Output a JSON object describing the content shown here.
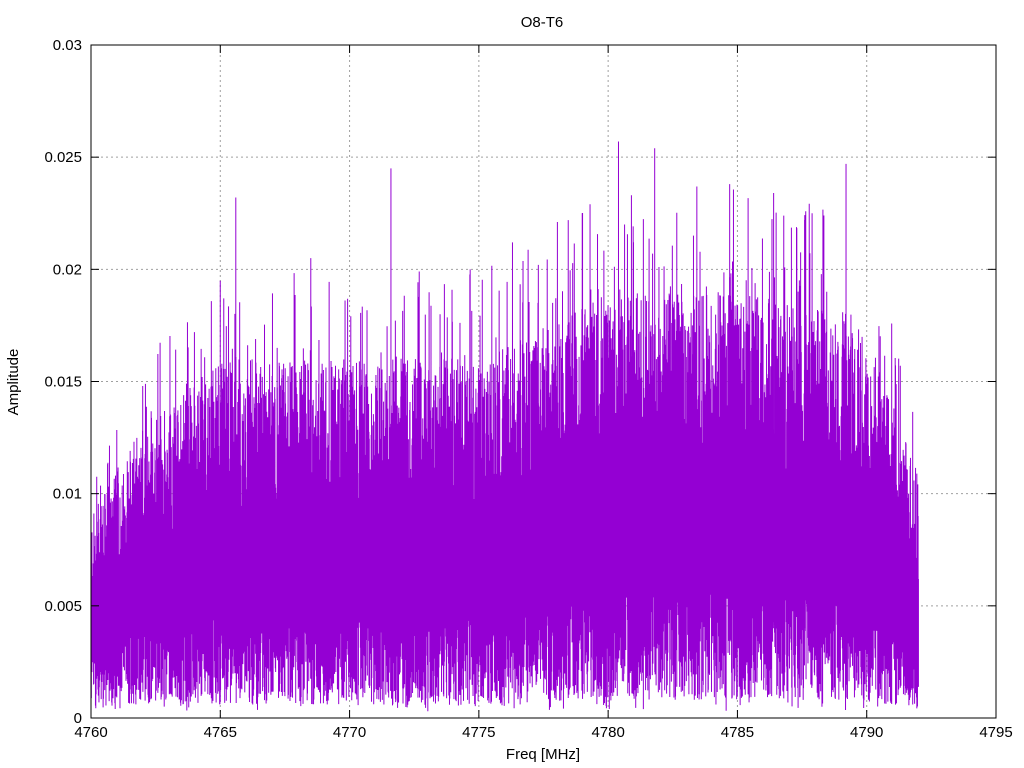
{
  "chart_data": {
    "type": "line",
    "title": "O8-T6",
    "xlabel": "Freq [MHz]",
    "ylabel": "Amplitude",
    "xlim": [
      4760,
      4795
    ],
    "ylim": [
      0,
      0.03
    ],
    "x_ticks": [
      4760,
      4765,
      4770,
      4775,
      4780,
      4785,
      4790,
      4795
    ],
    "x_tick_labels": [
      "4760",
      "4765",
      "4770",
      "4775",
      "4780",
      "4785",
      "4790",
      "4795"
    ],
    "y_ticks": [
      0,
      0.005,
      0.01,
      0.015,
      0.02,
      0.025,
      0.03
    ],
    "y_tick_labels": [
      "0",
      "0.005",
      "0.01",
      "0.015",
      "0.02",
      "0.025",
      "0.03"
    ],
    "grid": true,
    "series_color": "#9400d3",
    "signal": {
      "x_start": 4760,
      "x_end": 4792,
      "envelope_x": [
        4760,
        4762,
        4765,
        4770,
        4775,
        4780,
        4785,
        4789.5,
        4791,
        4792
      ],
      "envelope_upper": [
        0.009,
        0.013,
        0.016,
        0.016,
        0.016,
        0.019,
        0.019,
        0.018,
        0.014,
        0.011
      ],
      "envelope_lower": [
        0.002,
        0.003,
        0.003,
        0.003,
        0.003,
        0.004,
        0.004,
        0.004,
        0.003,
        0.002
      ],
      "peaks": [
        {
          "x": 4765.6,
          "y": 0.0232
        },
        {
          "x": 4771.6,
          "y": 0.0245
        },
        {
          "x": 4768.5,
          "y": 0.0205
        },
        {
          "x": 4776.3,
          "y": 0.0212
        },
        {
          "x": 4777.3,
          "y": 0.0202
        },
        {
          "x": 4780.4,
          "y": 0.0257
        },
        {
          "x": 4781.8,
          "y": 0.0254
        },
        {
          "x": 4780.9,
          "y": 0.0233
        },
        {
          "x": 4779.3,
          "y": 0.0229
        },
        {
          "x": 4784.7,
          "y": 0.0238
        },
        {
          "x": 4786.4,
          "y": 0.0234
        },
        {
          "x": 4789.2,
          "y": 0.0247
        },
        {
          "x": 4783.3,
          "y": 0.0215
        },
        {
          "x": 4787.6,
          "y": 0.0222
        },
        {
          "x": 4762.0,
          "y": 0.0148
        },
        {
          "x": 4764.0,
          "y": 0.0172
        },
        {
          "x": 4767.2,
          "y": 0.0165
        },
        {
          "x": 4773.5,
          "y": 0.018
        }
      ]
    }
  }
}
